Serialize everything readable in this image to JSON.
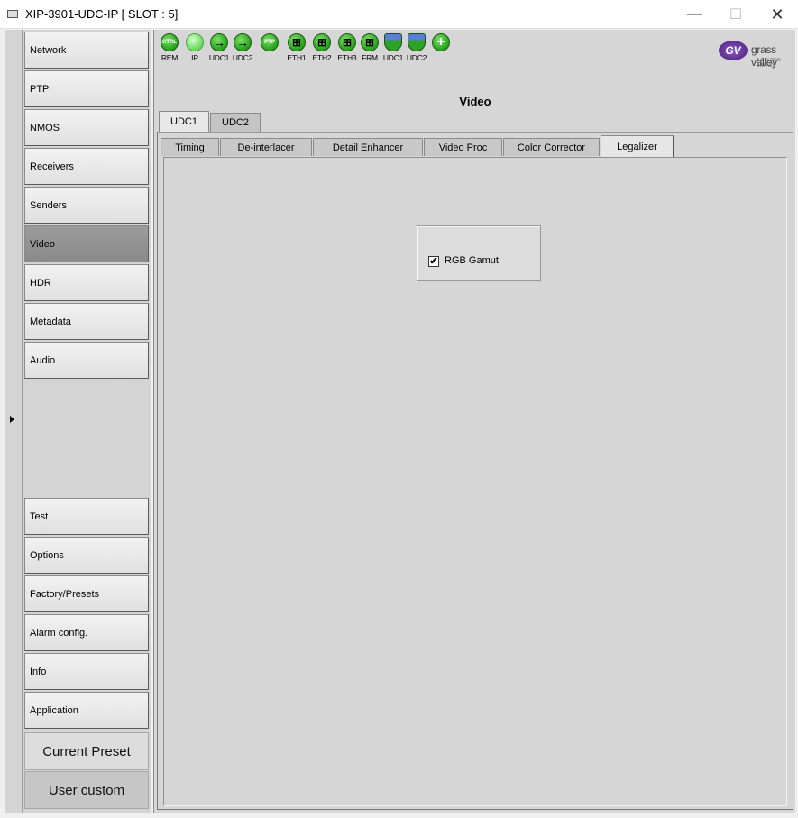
{
  "window": {
    "title": "XIP-3901-UDC-IP [ SLOT : 5]",
    "minimize_glyph": "—",
    "maximize_glyph": "☐",
    "close_glyph": "✕"
  },
  "sidebar": {
    "top_items": [
      {
        "label": "Network",
        "active": false
      },
      {
        "label": "PTP",
        "active": false
      },
      {
        "label": "NMOS",
        "active": false
      },
      {
        "label": "Receivers",
        "active": false
      },
      {
        "label": "Senders",
        "active": false
      },
      {
        "label": "Video",
        "active": true
      },
      {
        "label": "HDR",
        "active": false
      },
      {
        "label": "Metadata",
        "active": false
      },
      {
        "label": "Audio",
        "active": false
      }
    ],
    "bottom_items": [
      {
        "label": "Test"
      },
      {
        "label": "Options"
      },
      {
        "label": "Factory/Presets"
      },
      {
        "label": "Alarm config."
      },
      {
        "label": "Info"
      },
      {
        "label": "Application"
      }
    ],
    "current_preset_label": "Current Preset",
    "user_custom_label": "User custom"
  },
  "status_bar": {
    "items": [
      {
        "label": "REM",
        "icon": "ctrl-status-icon",
        "icon_text": "CTRL"
      },
      {
        "label": "IP",
        "icon": "ip-status-icon",
        "icon_text": ""
      },
      {
        "label": "UDC1",
        "icon": "udc1-arrow-status-icon",
        "icon_text": "→"
      },
      {
        "label": "UDC2",
        "icon": "udc2-arrow-status-icon",
        "icon_text": "→"
      },
      {
        "label": "",
        "icon": "ptp-status-icon",
        "icon_text": "PTP"
      },
      {
        "label": "ETH1",
        "icon": "eth1-status-icon",
        "icon_text": "⊞"
      },
      {
        "label": "ETH2",
        "icon": "eth2-status-icon",
        "icon_text": "⊞"
      },
      {
        "label": "ETH3",
        "icon": "eth3-status-icon",
        "icon_text": "⊞"
      },
      {
        "label": "FRM",
        "icon": "frm-status-icon",
        "icon_text": "⊞"
      },
      {
        "label": "UDC1",
        "icon": "udc1-output-status-icon",
        "icon_text": ""
      },
      {
        "label": "UDC2",
        "icon": "udc2-output-status-icon",
        "icon_text": ""
      },
      {
        "label": "",
        "icon": "add-status-icon",
        "icon_text": "+"
      }
    ],
    "status_color": "#23a11a"
  },
  "brand": {
    "name": "grass valley",
    "subtitle": "A BELDEN BRAND",
    "mark": "GV",
    "color": "#5b2d8e"
  },
  "panel": {
    "title": "Video",
    "channel_tabs": [
      {
        "label": "UDC1",
        "active": true
      },
      {
        "label": "UDC2",
        "active": false
      }
    ],
    "sub_tabs": [
      {
        "label": "Timing",
        "active": false
      },
      {
        "label": "De-interlacer",
        "active": false
      },
      {
        "label": "Detail Enhancer",
        "active": false
      },
      {
        "label": "Video Proc",
        "active": false
      },
      {
        "label": "Color Corrector",
        "active": false
      },
      {
        "label": "Legalizer",
        "active": true
      }
    ]
  },
  "legalizer": {
    "rgb_gamut_label": "RGB Gamut",
    "rgb_gamut_checked": true,
    "check_glyph": "✔"
  }
}
